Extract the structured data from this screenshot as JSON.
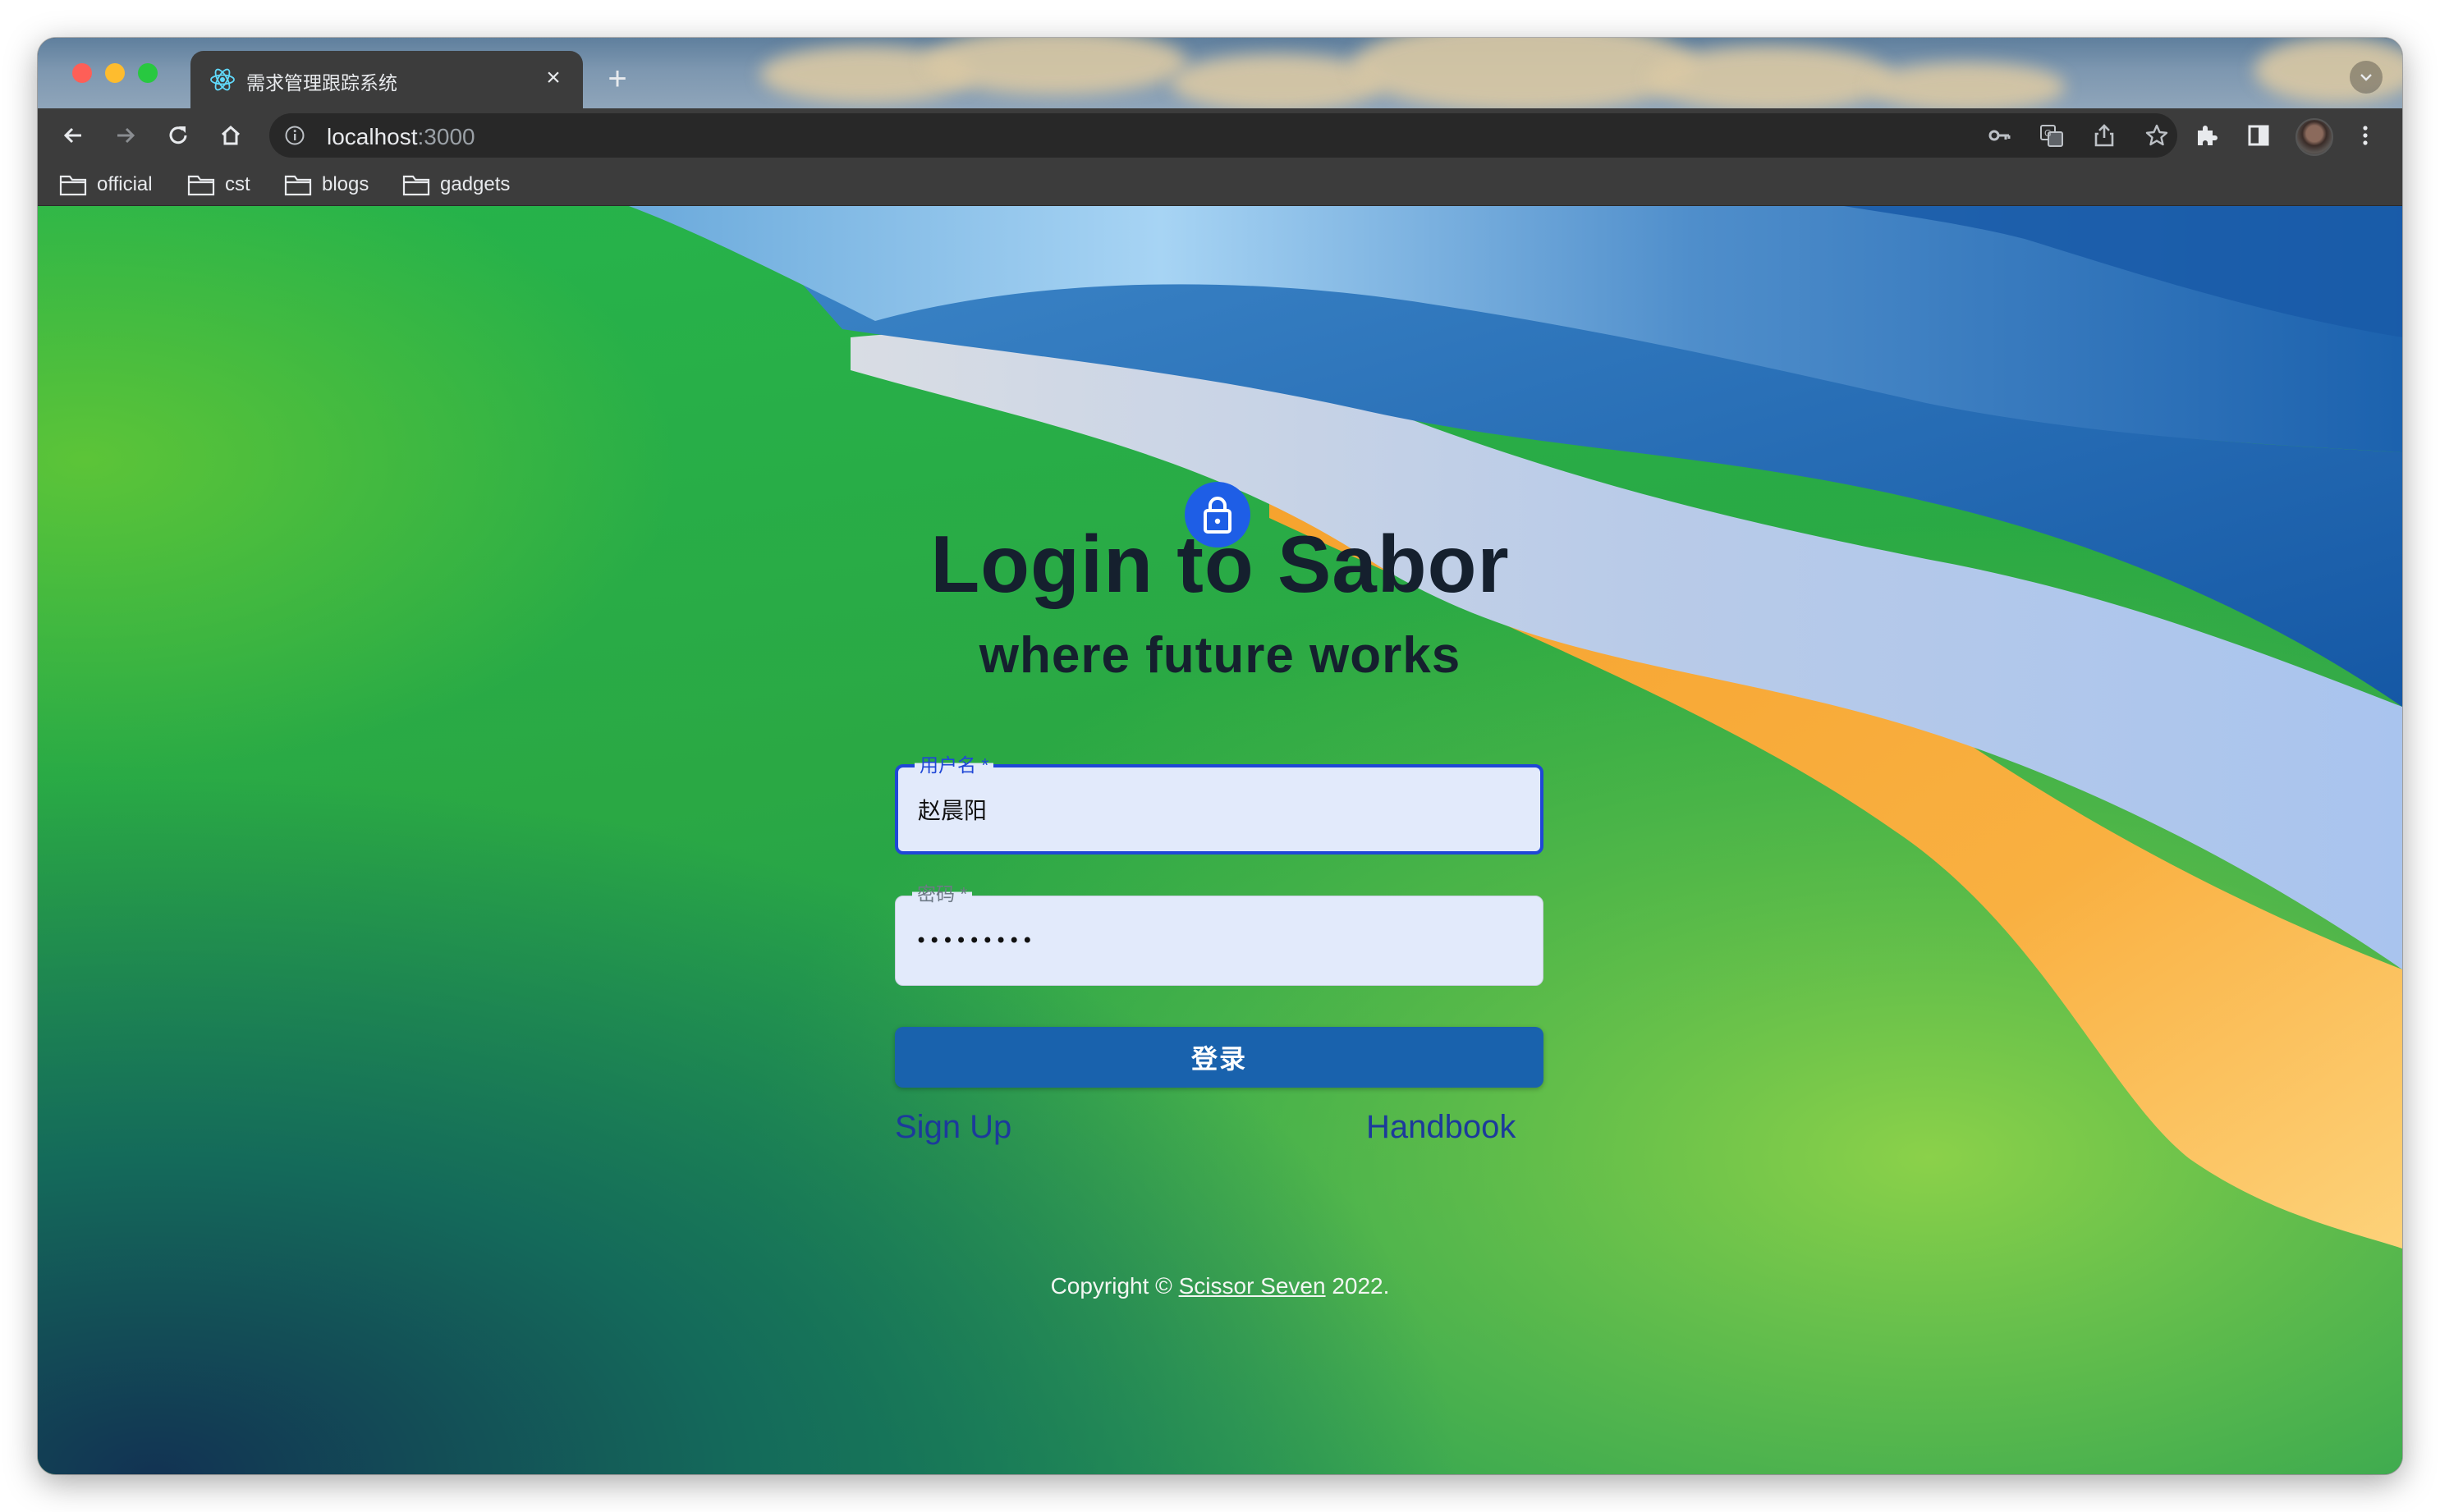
{
  "browser": {
    "tab_title": "需求管理跟踪系统",
    "tab_close": "×",
    "new_tab": "+",
    "url_host": "localhost",
    "url_port": ":3000",
    "bookmarks": [
      {
        "label": "official"
      },
      {
        "label": "cst"
      },
      {
        "label": "blogs"
      },
      {
        "label": "gadgets"
      }
    ]
  },
  "page": {
    "title": "Login to Sabor",
    "subtitle": "where future works",
    "username_label": "用户名 *",
    "username_value": "赵晨阳",
    "password_label": "密码 *",
    "password_value": "123456789",
    "login_button": "登录",
    "signup_link": "Sign Up",
    "handbook_link": "Handbook",
    "copyright_prefix": "Copyright © ",
    "copyright_owner": "Scissor Seven",
    "copyright_suffix": " 2022."
  },
  "colors": {
    "accent": "#1e5ee6",
    "button": "#1962ad",
    "link": "#1c3a9b",
    "field_bg": "#e2eafb"
  },
  "icons": [
    "react-icon",
    "back-icon",
    "forward-icon",
    "reload-icon",
    "home-icon",
    "info-icon",
    "key-icon",
    "translate-icon",
    "share-icon",
    "star-icon",
    "extensions-icon",
    "sidepanel-icon",
    "menu-icon",
    "folder-icon",
    "lock-icon"
  ]
}
